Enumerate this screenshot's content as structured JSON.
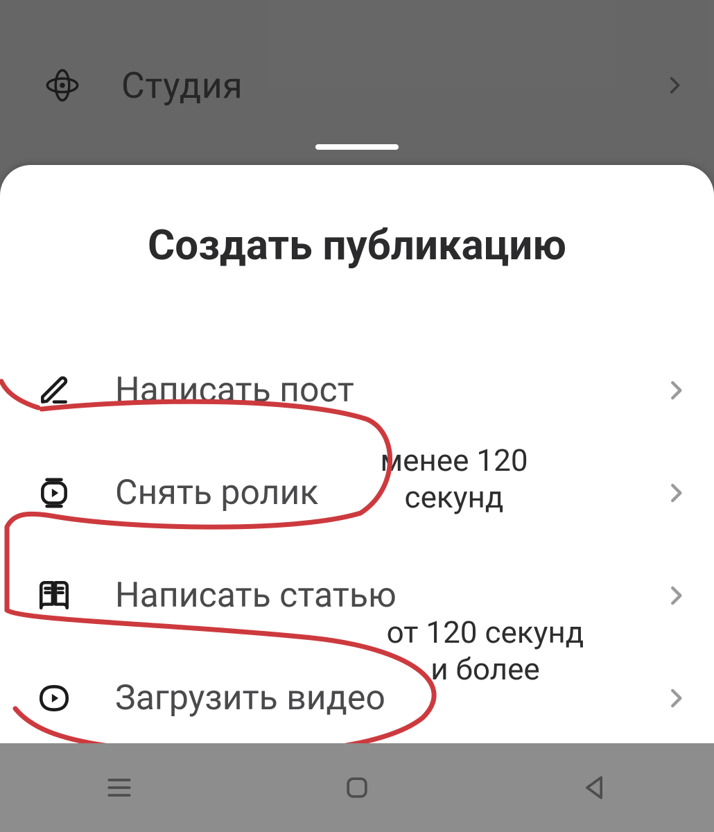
{
  "background_row": {
    "label": "Студия"
  },
  "sheet": {
    "title": "Создать публикацию",
    "options": [
      {
        "label": "Написать пост"
      },
      {
        "label": "Снять ролик"
      },
      {
        "label": "Написать статью"
      },
      {
        "label": "Загрузить видео"
      }
    ]
  },
  "annotations": {
    "clip_note": "менее 120\nсекунд",
    "video_note": "от 120 секунд\nи более",
    "stroke_color": "#cd3a3e"
  }
}
